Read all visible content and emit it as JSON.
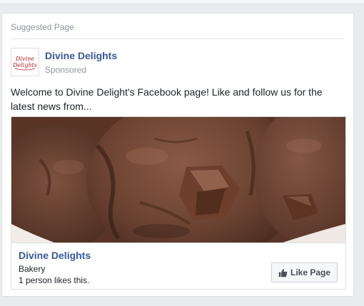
{
  "card": {
    "header": "Suggested Page",
    "page_name": "Divine Delights",
    "sponsored_label": "Sponsored",
    "logo_text": "Divine Delights",
    "post_text": "Welcome to Divine Delight's Facebook page! Like and follow us for the latest news from..."
  },
  "ad": {
    "image_icon": "chocolate-cookie-photo",
    "title": "Divine Delights",
    "category": "Bakery",
    "likes_text": "1 person likes this.",
    "like_button_label": "Like Page",
    "like_icon": "thumbs-up-icon"
  },
  "colors": {
    "link_blue": "#365899",
    "muted_text": "#90949c",
    "logo_red": "#b0202a"
  }
}
